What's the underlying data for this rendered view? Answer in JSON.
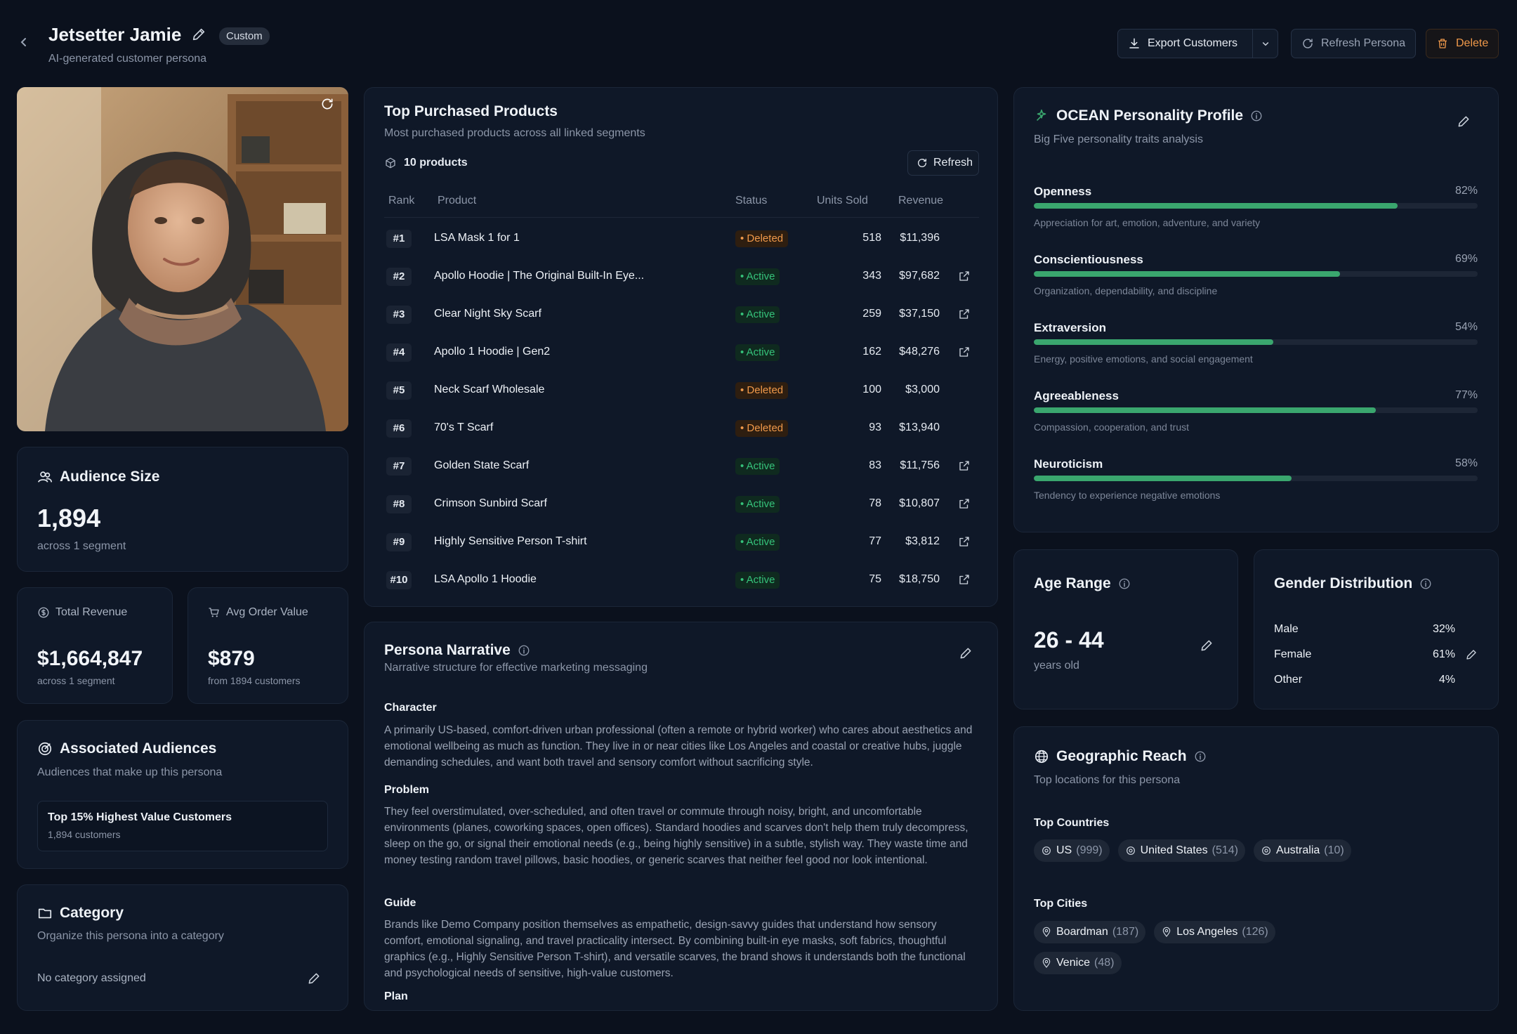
{
  "header": {
    "title": "Jetsetter Jamie",
    "badge": "Custom",
    "subtitle": "AI-generated customer persona",
    "export_label": "Export Customers",
    "refresh_label": "Refresh Persona",
    "delete_label": "Delete"
  },
  "audience": {
    "title": "Audience Size",
    "value": "1,894",
    "sub": "across 1 segment"
  },
  "revenue": {
    "title": "Total Revenue",
    "value": "$1,664,847",
    "sub": "across 1 segment"
  },
  "aov": {
    "title": "Avg Order Value",
    "value": "$879",
    "sub": "from 1894 customers"
  },
  "associated": {
    "title": "Associated Audiences",
    "sub": "Audiences that make up this persona",
    "item_name": "Top 15% Highest Value Customers",
    "item_count": "1,894 customers"
  },
  "category": {
    "title": "Category",
    "sub": "Organize this persona into a category",
    "value": "No category assigned"
  },
  "products": {
    "title": "Top Purchased Products",
    "sub": "Most purchased products across all linked segments",
    "count_label": "10 products",
    "refresh_label": "Refresh",
    "columns": [
      "Rank",
      "Product",
      "Status",
      "Units Sold",
      "Revenue"
    ],
    "rows": [
      {
        "rank": "#1",
        "name": "LSA Mask 1 for 1",
        "status": "Deleted",
        "units": "518",
        "revenue": "$11,396",
        "link": false
      },
      {
        "rank": "#2",
        "name": "Apollo Hoodie | The Original Built-In Eye...",
        "status": "Active",
        "units": "343",
        "revenue": "$97,682",
        "link": true
      },
      {
        "rank": "#3",
        "name": "Clear Night Sky Scarf",
        "status": "Active",
        "units": "259",
        "revenue": "$37,150",
        "link": true
      },
      {
        "rank": "#4",
        "name": "Apollo 1 Hoodie | Gen2",
        "status": "Active",
        "units": "162",
        "revenue": "$48,276",
        "link": true
      },
      {
        "rank": "#5",
        "name": "Neck Scarf Wholesale",
        "status": "Deleted",
        "units": "100",
        "revenue": "$3,000",
        "link": false
      },
      {
        "rank": "#6",
        "name": "70's T Scarf",
        "status": "Deleted",
        "units": "93",
        "revenue": "$13,940",
        "link": false
      },
      {
        "rank": "#7",
        "name": "Golden State Scarf",
        "status": "Active",
        "units": "83",
        "revenue": "$11,756",
        "link": true
      },
      {
        "rank": "#8",
        "name": "Crimson Sunbird Scarf",
        "status": "Active",
        "units": "78",
        "revenue": "$10,807",
        "link": true
      },
      {
        "rank": "#9",
        "name": "Highly Sensitive Person T-shirt",
        "status": "Active",
        "units": "77",
        "revenue": "$3,812",
        "link": true
      },
      {
        "rank": "#10",
        "name": "LSA Apollo 1 Hoodie",
        "status": "Active",
        "units": "75",
        "revenue": "$18,750",
        "link": true
      }
    ]
  },
  "narrative": {
    "title": "Persona Narrative",
    "sub": "Narrative structure for effective marketing messaging",
    "character_h": "Character",
    "character": "A primarily US-based, comfort-driven urban professional (often a remote or hybrid worker) who cares about aesthetics and emotional wellbeing as much as function. They live in or near cities like Los Angeles and coastal or creative hubs, juggle demanding schedules, and want both travel and sensory comfort without sacrificing style.",
    "problem_h": "Problem",
    "problem": "They feel overstimulated, over-scheduled, and often travel or commute through noisy, bright, and uncomfortable environments (planes, coworking spaces, open offices). Standard hoodies and scarves don't help them truly decompress, sleep on the go, or signal their emotional needs (e.g., being highly sensitive) in a subtle, stylish way. They waste time and money testing random travel pillows, basic hoodies, or generic scarves that neither feel good nor look intentional.",
    "guide_h": "Guide",
    "guide": "Brands like Demo Company position themselves as empathetic, design-savvy guides that understand how sensory comfort, emotional signaling, and travel practicality intersect. By combining built-in eye masks, soft fabrics, thoughtful graphics (e.g., Highly Sensitive Person T-shirt), and versatile scarves, the brand shows it understands both the functional and psychological needs of sensitive, high-value customers.",
    "plan_h": "Plan"
  },
  "ocean": {
    "title": "OCEAN Personality Profile",
    "sub": "Big Five personality traits analysis",
    "traits": [
      {
        "name": "Openness",
        "pct": "82%",
        "value": 0.82,
        "desc": "Appreciation for art, emotion, adventure, and variety"
      },
      {
        "name": "Conscientiousness",
        "pct": "69%",
        "value": 0.69,
        "desc": "Organization, dependability, and discipline"
      },
      {
        "name": "Extraversion",
        "pct": "54%",
        "value": 0.54,
        "desc": "Energy, positive emotions, and social engagement"
      },
      {
        "name": "Agreeableness",
        "pct": "77%",
        "value": 0.77,
        "desc": "Compassion, cooperation, and trust"
      },
      {
        "name": "Neuroticism",
        "pct": "58%",
        "value": 0.58,
        "desc": "Tendency to experience negative emotions"
      }
    ]
  },
  "age": {
    "title": "Age Range",
    "value": "26 - 44",
    "sub": "years old"
  },
  "gender": {
    "title": "Gender Distribution",
    "rows": [
      {
        "label": "Male",
        "pct": "32%"
      },
      {
        "label": "Female",
        "pct": "61%"
      },
      {
        "label": "Other",
        "pct": "4%"
      }
    ]
  },
  "geo": {
    "title": "Geographic Reach",
    "sub": "Top locations for this persona",
    "countries_h": "Top Countries",
    "countries": [
      {
        "name": "US",
        "count": "(999)"
      },
      {
        "name": "United States",
        "count": "(514)"
      },
      {
        "name": "Australia",
        "count": "(10)"
      }
    ],
    "cities_h": "Top Cities",
    "cities": [
      {
        "name": "Boardman",
        "count": "(187)"
      },
      {
        "name": "Los Angeles",
        "count": "(126)"
      },
      {
        "name": "Venice",
        "count": "(48)"
      }
    ]
  },
  "colors": {
    "accent_green": "#3aa66e",
    "active": "#35c27a",
    "deleted": "#f0994a",
    "background": "#0b111d"
  }
}
